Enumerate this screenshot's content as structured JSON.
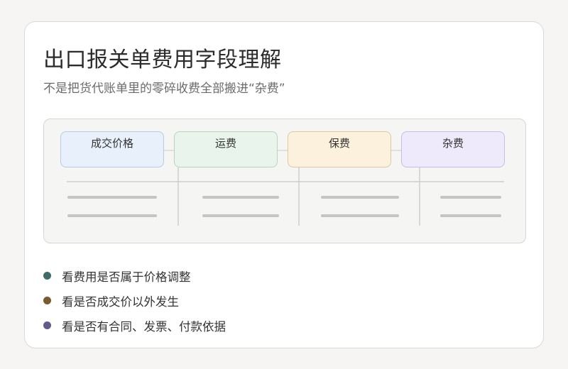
{
  "title": "出口报关单费用字段理解",
  "subtitle": "不是把货代账单里的零碎收费全部搬进“杂费”",
  "fields": [
    {
      "label": "成交价格"
    },
    {
      "label": "运费"
    },
    {
      "label": "保费"
    },
    {
      "label": "杂费"
    }
  ],
  "colors": {
    "tag_fills": [
      "#e7f0fb",
      "#e9f5ec",
      "#fcf1dc",
      "#eeeafb"
    ],
    "bullet_dots": [
      "#3f6b68",
      "#7a5a30",
      "#615a8a"
    ]
  },
  "bullets": [
    {
      "text": "看费用是否属于价格调整"
    },
    {
      "text": "看是否成交价以外发生"
    },
    {
      "text": "看是否有合同、发票、付款依据"
    }
  ]
}
